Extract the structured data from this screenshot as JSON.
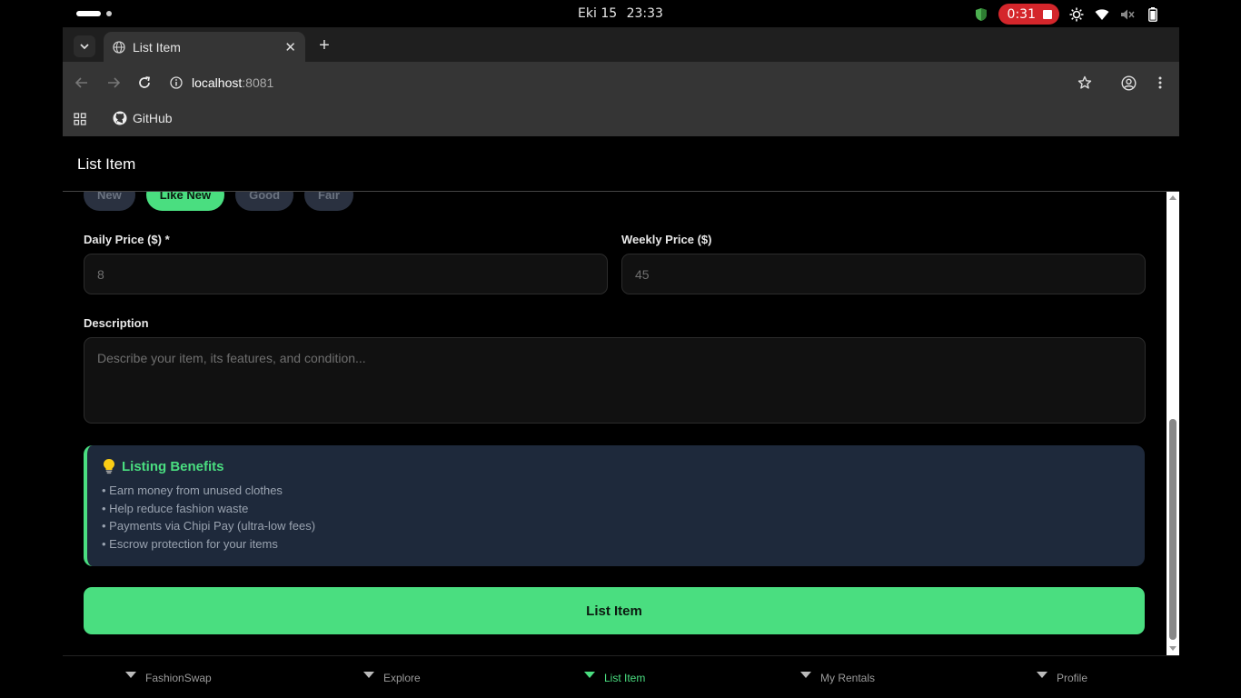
{
  "os": {
    "date": "Eki 15",
    "time": "23:33",
    "recording_time": "0:31"
  },
  "browser": {
    "tab_title": "List Item",
    "url_host": "localhost",
    "url_port": ":8081",
    "bookmark_label": "GitHub"
  },
  "app": {
    "header_title": "List Item",
    "condition_options": [
      {
        "label": "New",
        "selected": false
      },
      {
        "label": "Like New",
        "selected": true
      },
      {
        "label": "Good",
        "selected": false
      },
      {
        "label": "Fair",
        "selected": false
      }
    ],
    "daily_price": {
      "label": "Daily Price ($) *",
      "value": "8"
    },
    "weekly_price": {
      "label": "Weekly Price ($)",
      "value": "45"
    },
    "description": {
      "label": "Description",
      "placeholder": "Describe your item, its features, and condition..."
    },
    "benefits": {
      "icon": "lightbulb-icon",
      "title": "Listing Benefits",
      "items": [
        "• Earn money from unused clothes",
        "• Help reduce fashion waste",
        "• Payments via Chipi Pay (ultra-low fees)",
        "• Escrow protection for your items"
      ]
    },
    "submit_label": "List Item",
    "bottom_nav": [
      {
        "label": "FashionSwap",
        "active": false
      },
      {
        "label": "Explore",
        "active": false
      },
      {
        "label": "List Item",
        "active": true
      },
      {
        "label": "My Rentals",
        "active": false
      },
      {
        "label": "Profile",
        "active": false
      }
    ]
  },
  "colors": {
    "accent": "#4ade80",
    "benefits_bg": "#1e293b",
    "record": "#d4262b"
  }
}
